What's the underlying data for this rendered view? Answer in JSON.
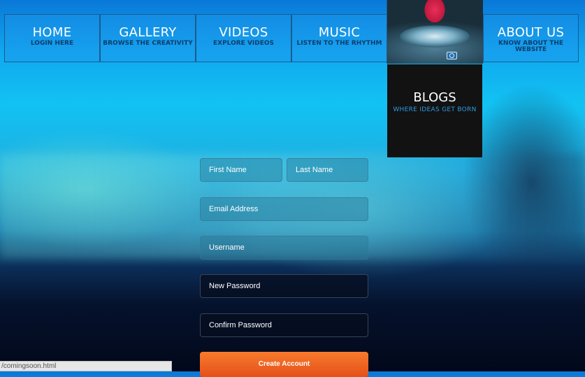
{
  "nav": {
    "items": [
      {
        "title": "HOME",
        "subtitle": "LOGIN HERE"
      },
      {
        "title": "GALLERY",
        "subtitle": "BROWSE THE CREATIVITY"
      },
      {
        "title": "VIDEOS",
        "subtitle": "EXPLORE VIDEOS"
      },
      {
        "title": "MUSIC",
        "subtitle": "LISTEN TO THE RHYTHM"
      },
      {
        "title": "ABOUT US",
        "subtitle": "KNOW ABOUT THE WEBSITE"
      }
    ],
    "blogs": {
      "title": "BLOGS",
      "subtitle": "WHERE IDEAS GET BORN",
      "icon": "camera-icon"
    }
  },
  "form": {
    "first_name": "First Name",
    "last_name": "Last Name",
    "email": "Email Address",
    "username": "Username",
    "new_password": "New Password",
    "confirm_password": "Confirm Password",
    "submit_label": "Create Account"
  },
  "status_bar": {
    "url": "/comingsoon.html"
  },
  "colors": {
    "accent": "#f26522",
    "nav_blue": "#1e96eb",
    "blogs_bg": "#121212",
    "blogs_subtitle": "#2f9adf"
  }
}
